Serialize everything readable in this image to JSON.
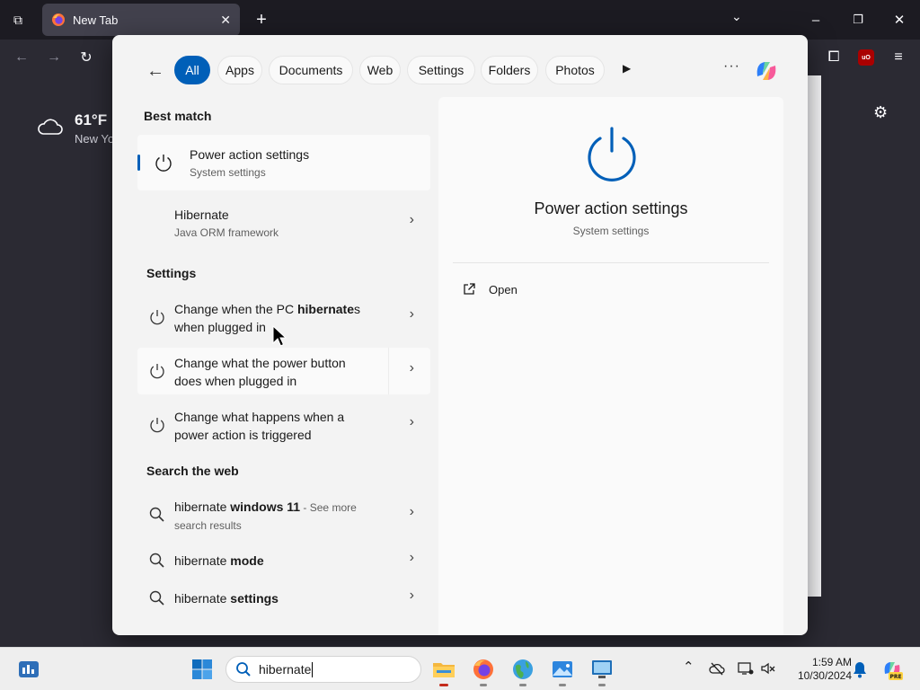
{
  "browser": {
    "tab_title": "New Tab",
    "close_glyph": "✕",
    "new_tab_glyph": "+",
    "tab_list_glyph": "⧉",
    "tab_dropdown_glyph": "⌄",
    "win_min": "–",
    "win_restore": "❐",
    "win_close": "✕",
    "back_glyph": "←",
    "forward_glyph": "→",
    "reload_glyph": "↻",
    "extensions_glyph": "⧠",
    "menu_glyph": "≡",
    "ublock_label": "uO",
    "settings_glyph": "⚙"
  },
  "newtab": {
    "temperature": "61°F",
    "city": "New Yo"
  },
  "search_panel": {
    "back_glyph": "←",
    "filters": [
      "All",
      "Apps",
      "Documents",
      "Web",
      "Settings",
      "Folders",
      "Photos"
    ],
    "active_filter": "All",
    "more_filters_glyph": "▶",
    "more_options_glyph": "···",
    "best_match": {
      "header": "Best match",
      "title": "Power action settings",
      "subtitle": "System settings"
    },
    "apps": [
      {
        "title": "Hibernate",
        "subtitle": "Java ORM framework"
      }
    ],
    "settings": {
      "header": "Settings",
      "items": [
        {
          "pre": "Change when the PC ",
          "bold": "hibernate",
          "post": "s",
          "line2": "when plugged in"
        },
        {
          "pre": "Change what the power button",
          "bold": "",
          "post": "",
          "line2": "does when plugged in"
        },
        {
          "pre": "Change what happens when a",
          "bold": "",
          "post": "",
          "line2": "power action is triggered"
        }
      ]
    },
    "web": {
      "header": "Search the web",
      "items": [
        {
          "pre": "hibernate ",
          "bold": "windows 11",
          "hint": " - See more",
          "line2": "search results"
        },
        {
          "pre": "hibernate ",
          "bold": "mode"
        },
        {
          "pre": "hibernate ",
          "bold": "settings"
        }
      ]
    },
    "chevron_glyph": "›",
    "preview": {
      "title": "Power action settings",
      "subtitle": "System settings",
      "open_label": "Open"
    }
  },
  "taskbar": {
    "search_value": "hibernate",
    "time": "1:59 AM",
    "date": "10/30/2024",
    "tray_overflow_glyph": "⌃",
    "copilot_badge": "PRE"
  },
  "colors": {
    "accent": "#005fb8",
    "browser_bg": "#1c1b22",
    "browser_toolbar": "#2b2a33",
    "panel_bg": "#f3f3f3"
  }
}
